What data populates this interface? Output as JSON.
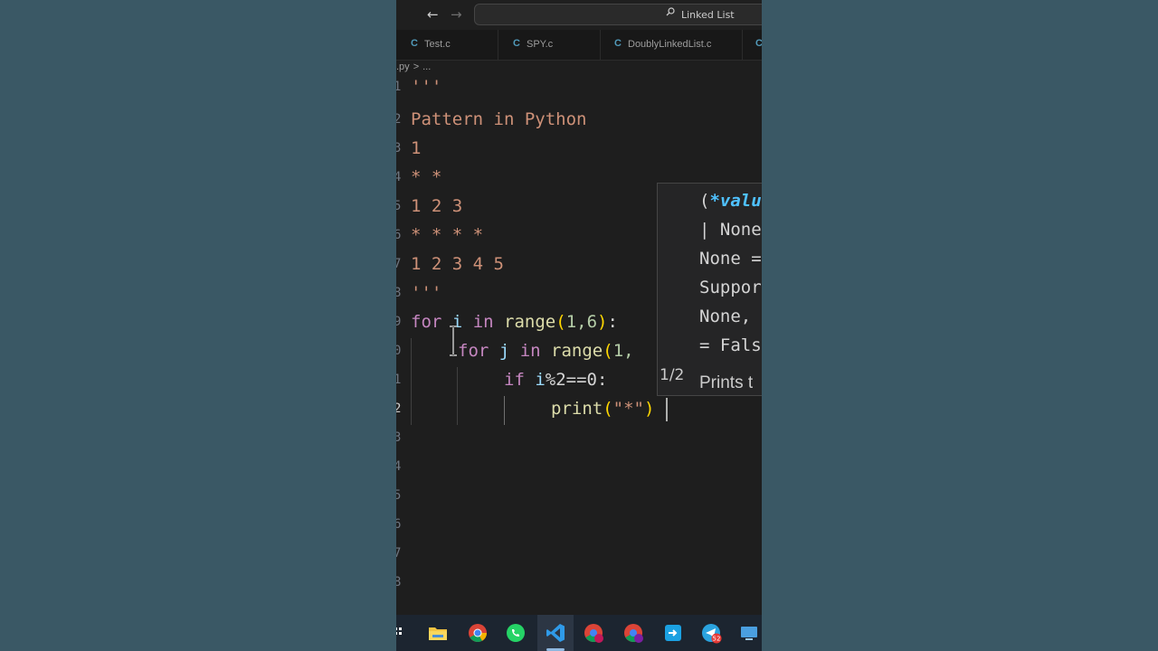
{
  "titlebar": {
    "back_arrow": "←",
    "forward_arrow": "→",
    "search_text": "Linked List"
  },
  "tabs": [
    {
      "icon": "C",
      "label": "Test.c"
    },
    {
      "icon": "C",
      "label": "SPY.c"
    },
    {
      "icon": "C",
      "label": "DoublyLinkedList.c"
    },
    {
      "icon": "C",
      "label": ""
    }
  ],
  "breadcrumb": {
    "file": ".py",
    "separator": ">",
    "rest": "..."
  },
  "line_numbers": [
    "1",
    "2",
    "3",
    "4",
    "5",
    "6",
    "7",
    "8",
    "9",
    "0",
    "1",
    "2",
    "3",
    "4",
    "5",
    "6",
    "7",
    "8"
  ],
  "code": {
    "l1": "'''",
    "l2": "Pattern in Python",
    "l3": "1",
    "l4": "* *",
    "l5": "1 2 3",
    "l6": "* * * *",
    "l7": "1 2 3 4 5",
    "l8": "'''",
    "l9_for": "for",
    "l9_i": "i",
    "l9_in": "in",
    "l9_range": "range",
    "l9_open": "(",
    "l9_args": "1,6",
    "l9_close": ")",
    "l9_colon": ":",
    "l10_for": "for",
    "l10_j": "j",
    "l10_in": "in",
    "l10_range": "range",
    "l10_open": "(",
    "l10_args": "1,",
    "l11_if": "if",
    "l11_i": "i",
    "l11_rest": "%2==0:",
    "l12_print": "print",
    "l12_open": "(",
    "l12_str": "\"*\"",
    "l12_close": ")"
  },
  "popup": {
    "line1_paren": "(",
    "line1_param": "*valu",
    "line2": "| None",
    "line3": "None =",
    "line4": "Suppor",
    "line5": "None,",
    "line6": "= Fals",
    "counter": "1/2",
    "doc": "Prints t"
  },
  "taskbar_icons": [
    "search-icon",
    "file-explorer-icon",
    "chrome-icon",
    "whatsapp-icon",
    "vscode-icon",
    "chrome-profile-u-icon",
    "chrome-profile-v-icon",
    "app-icon",
    "telegram-icon",
    "remote-desktop-icon"
  ],
  "taskbar_badge": "52",
  "colors": {
    "background": "#3a5865",
    "editor": "#1e1e1e",
    "string": "#ce9178",
    "keyword": "#c586c0",
    "function": "#dcdcaa",
    "variable": "#9cdcfe"
  }
}
